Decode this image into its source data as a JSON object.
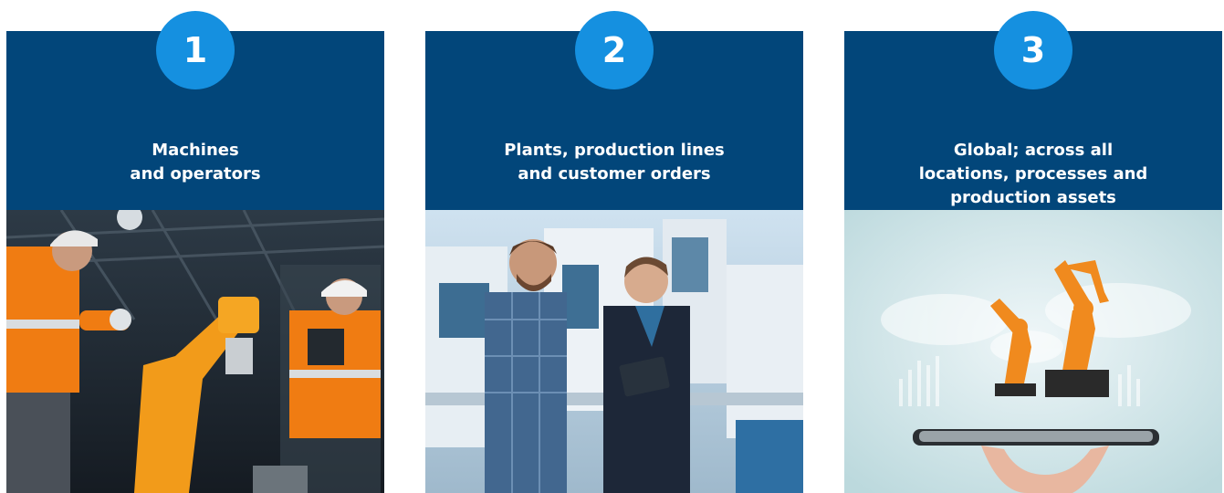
{
  "cards": [
    {
      "number": "1",
      "title_lines": [
        "Machines",
        "and operators"
      ],
      "image": "industrial-workers-robot-arm-photo"
    },
    {
      "number": "2",
      "title_lines": [
        "Plants, production lines",
        "and customer orders"
      ],
      "image": "factory-managers-tablet-photo"
    },
    {
      "number": "3",
      "title_lines": [
        "Global; across all",
        "locations, processes and",
        "production assets"
      ],
      "image": "robot-arm-on-smartphone-photo"
    }
  ],
  "colors": {
    "header_bg": "#02467a",
    "badge_bg": "#1590e0",
    "text": "#ffffff"
  }
}
